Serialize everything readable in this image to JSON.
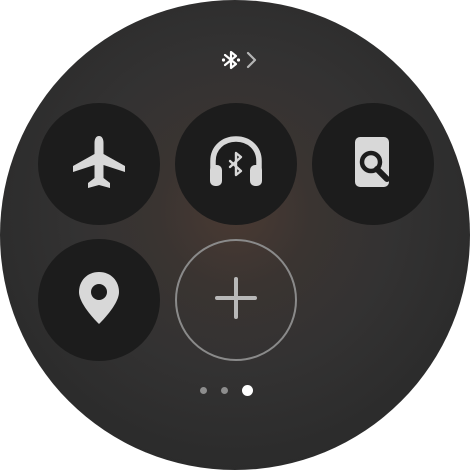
{
  "status": {
    "icons": [
      "bluetooth-icon",
      "chevron-right-icon"
    ]
  },
  "tiles": [
    {
      "name": "airplane-mode-toggle",
      "icon": "airplane-icon",
      "state": "off"
    },
    {
      "name": "bluetooth-headphones-toggle",
      "icon": "bluetooth-headphones-icon",
      "state": "off"
    },
    {
      "name": "find-device-toggle",
      "icon": "phone-search-icon",
      "state": "off"
    },
    {
      "name": "location-toggle",
      "icon": "location-pin-icon",
      "state": "off"
    },
    {
      "name": "add-tile-button",
      "icon": "plus-icon"
    }
  ],
  "pager": {
    "page_count": 3,
    "current_page": 3
  },
  "colors": {
    "tile_bg": "#1c1c1c",
    "icon": "#d8d8d8",
    "add_ring": "#8a8a8a",
    "dot_inactive": "#8d8d8d",
    "dot_active": "#ffffff"
  }
}
